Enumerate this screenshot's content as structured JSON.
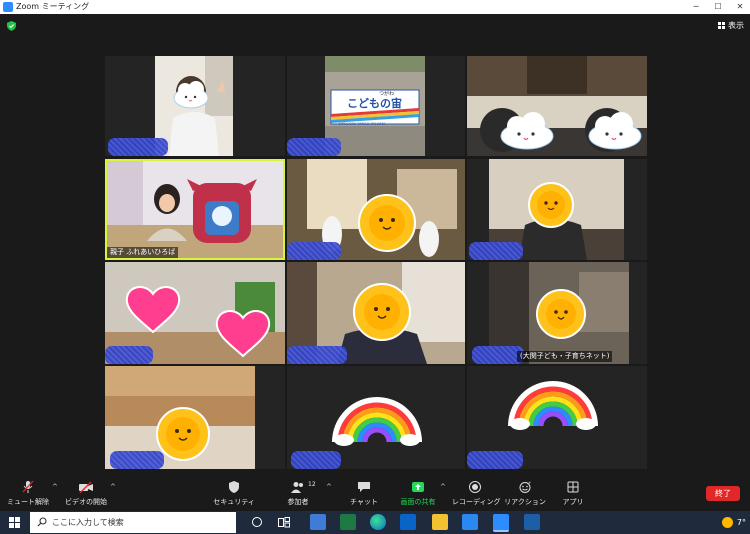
{
  "window": {
    "title": "Zoom ミーティング"
  },
  "top": {
    "view_label": "表示"
  },
  "tiles": {
    "t5_name": "親子 ふれあいひろば",
    "t11_name": "(大関子ども・子育ちネット)",
    "sign_top": "つがわ",
    "sign_main": "こどもの宙",
    "sign_sub": "NPOSORA TANGO YAHAMA"
  },
  "toolbar": {
    "mute": "ミュート解除",
    "video": "ビデオの開始",
    "security": "セキュリティ",
    "participants": "参加者",
    "participants_count": "12",
    "chat": "チャット",
    "share": "画面の共有",
    "record": "レコーディング",
    "reaction": "リアクション",
    "apps": "アプリ",
    "end": "終了"
  },
  "taskbar": {
    "search_placeholder": "ここに入力して検索",
    "temp": "7°"
  },
  "colors": {
    "share_green": "#23d959",
    "end_red": "#e02828",
    "active_border": "#d9f53a",
    "name_mask": "#3344cc"
  }
}
